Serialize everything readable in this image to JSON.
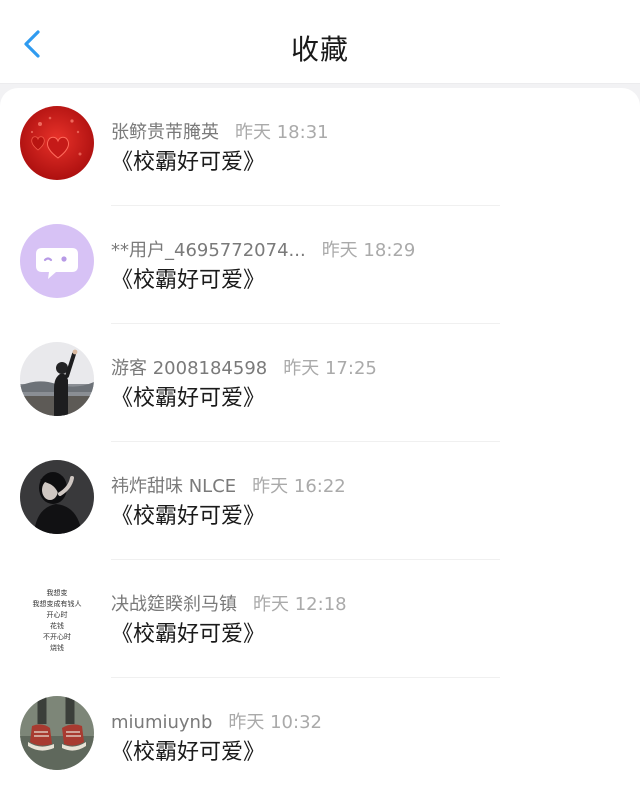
{
  "header": {
    "title": "收藏",
    "back_icon": "chevron-left-icon",
    "accent": "#2f9bf0"
  },
  "items": [
    {
      "user": "张鲚贵芾腌英",
      "time": "昨天 18:31",
      "message": "《校霸好可爱》",
      "avatar": "red-hearts-avatar"
    },
    {
      "user": "**用户_4695772074...",
      "time": "昨天 18:29",
      "message": "《校霸好可爱》",
      "avatar": "purple-chat-bubble-avatar"
    },
    {
      "user": "游客 2008184598",
      "time": "昨天 17:25",
      "message": "《校霸好可爱》",
      "avatar": "girl-waving-avatar"
    },
    {
      "user": "祎炸甜味 NLCE",
      "time": "昨天 16:22",
      "message": "《校霸好可爱》",
      "avatar": "girl-dark-portrait-avatar"
    },
    {
      "user": "决战筵睽刹马镇",
      "time": "昨天 12:18",
      "message": "《校霸好可爱》",
      "avatar": "text-quote-avatar",
      "avatar_text": [
        "我想变",
        "我想变成有钱人",
        "开心时",
        "花钱",
        "不开心时",
        "烧钱"
      ]
    },
    {
      "user": "miumiuynb",
      "time": "昨天 10:32",
      "message": "《校霸好可爱》",
      "avatar": "sneakers-avatar"
    }
  ]
}
